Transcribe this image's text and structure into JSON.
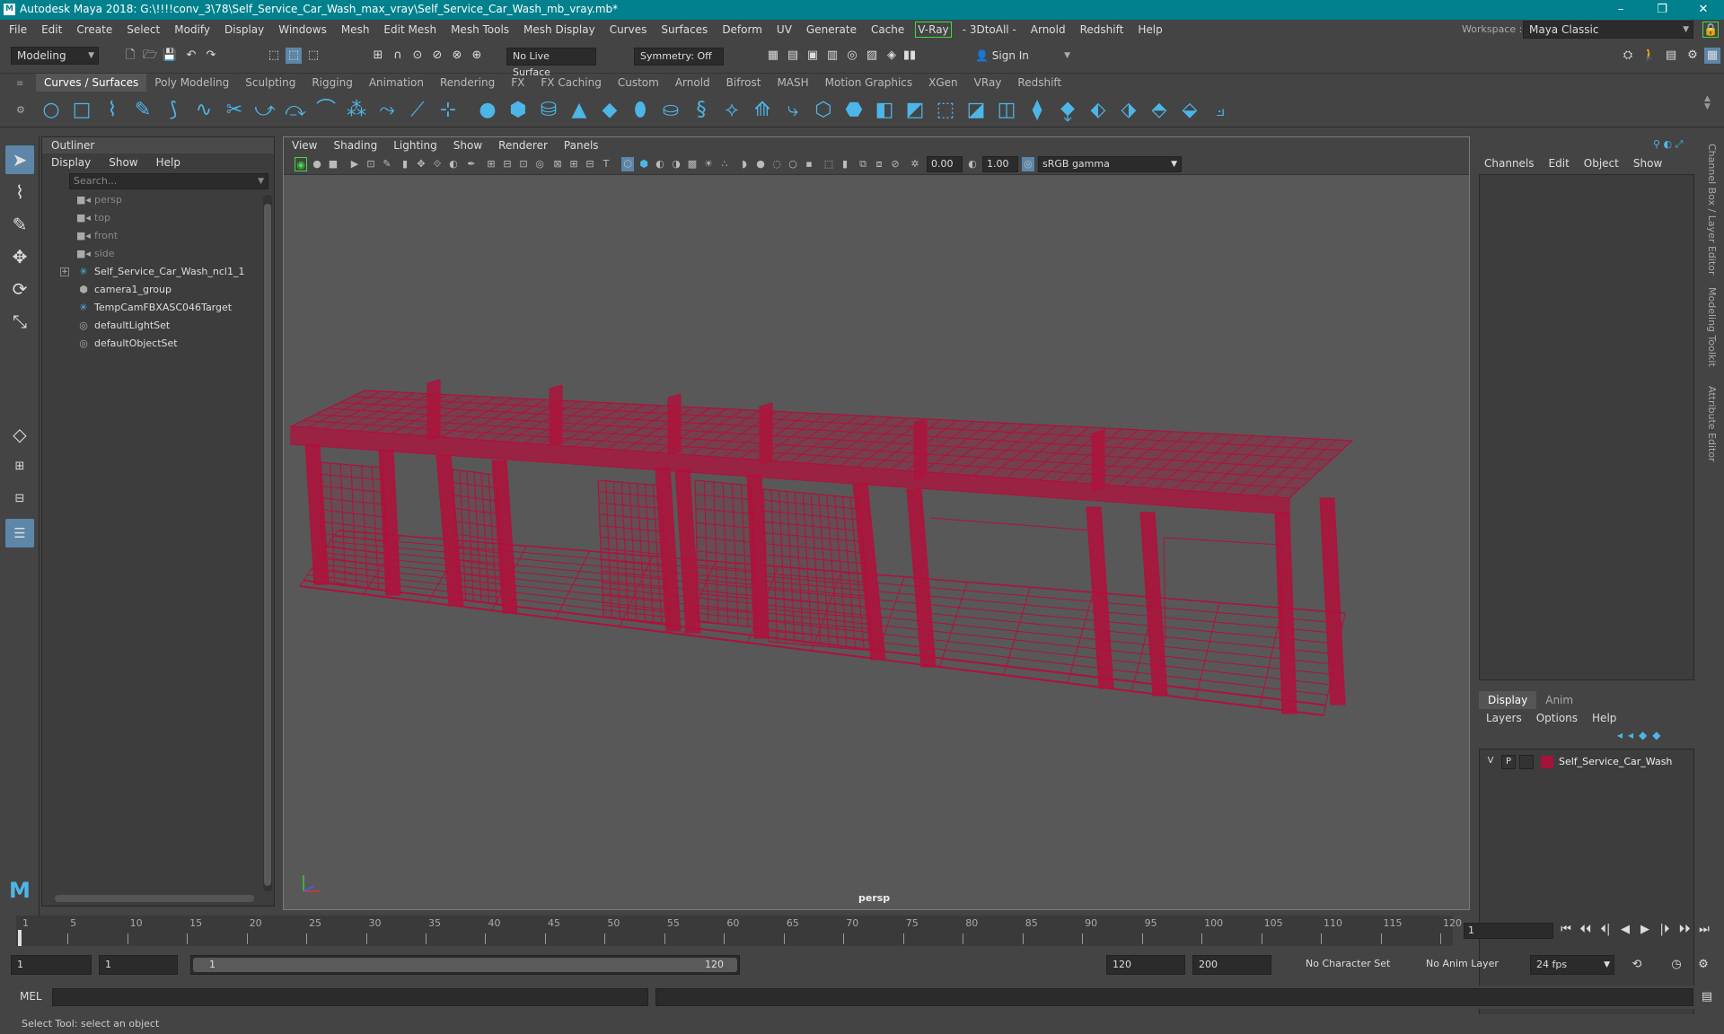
{
  "window": {
    "title": "Autodesk Maya 2018: G:\\!!!!conv_3\\78\\Self_Service_Car_Wash_max_vray\\Self_Service_Car_Wash_mb_vray.mb*",
    "controls": [
      "–",
      "❐",
      "✕"
    ]
  },
  "menubar": {
    "items": [
      "File",
      "Edit",
      "Create",
      "Select",
      "Modify",
      "Display",
      "Windows",
      "Mesh",
      "Edit Mesh",
      "Mesh Tools",
      "Mesh Display",
      "Curves",
      "Surfaces",
      "Deform",
      "UV",
      "Generate",
      "Cache"
    ],
    "vray": "V-Ray",
    "items2": [
      "- 3DtoAll -",
      "Arnold",
      "Redshift",
      "Help"
    ],
    "workspace_label": "Workspace :",
    "workspace_value": "Maya Classic"
  },
  "statusline": {
    "mode": "Modeling",
    "live_surface": "No Live Surface",
    "symmetry": "Symmetry: Off",
    "sign_in": "Sign In"
  },
  "shelf": {
    "tabs": [
      "Curves / Surfaces",
      "Poly Modeling",
      "Sculpting",
      "Rigging",
      "Animation",
      "Rendering",
      "FX",
      "FX Caching",
      "Custom",
      "Arnold",
      "Bifrost",
      "MASH",
      "Motion Graphics",
      "XGen",
      "VRay",
      "Redshift"
    ],
    "active_tab": "Curves / Surfaces"
  },
  "outliner": {
    "title": "Outliner",
    "menu": [
      "Display",
      "Show",
      "Help"
    ],
    "search_placeholder": "Search...",
    "items": [
      {
        "label": "persp",
        "icon": "camera-icon",
        "dim": true
      },
      {
        "label": "top",
        "icon": "camera-icon",
        "dim": true
      },
      {
        "label": "front",
        "icon": "camera-icon",
        "dim": true
      },
      {
        "label": "side",
        "icon": "camera-icon",
        "dim": true
      },
      {
        "label": "Self_Service_Car_Wash_ncl1_1",
        "icon": "transform-icon",
        "dim": false,
        "expandable": true
      },
      {
        "label": "camera1_group",
        "icon": "group-icon",
        "dim": false
      },
      {
        "label": "TempCamFBXASC046Target",
        "icon": "transform-icon",
        "dim": false
      },
      {
        "label": "defaultLightSet",
        "icon": "set-icon",
        "dim": false
      },
      {
        "label": "defaultObjectSet",
        "icon": "set-icon",
        "dim": false
      }
    ]
  },
  "viewport": {
    "menu": [
      "View",
      "Shading",
      "Lighting",
      "Show",
      "Renderer",
      "Panels"
    ],
    "exposure": "0.00",
    "gamma": "1.00",
    "colorspace": "sRGB gamma",
    "camera_label": "persp",
    "wire_color": "#b0113c"
  },
  "channelbox": {
    "menu": [
      "Channels",
      "Edit",
      "Object",
      "Show"
    ],
    "layer_tabs": [
      "Display",
      "Anim"
    ],
    "active_layer_tab": "Display",
    "layer_menu": [
      "Layers",
      "Options",
      "Help"
    ],
    "layer": {
      "v": "V",
      "p": "P",
      "name": "Self_Service_Car_Wash",
      "color": "#a4143a"
    },
    "side_tabs": [
      "Channel Box / Layer Editor",
      "Modeling Toolkit",
      "Attribute Editor"
    ]
  },
  "timeslider": {
    "ticks": [
      "1",
      "5",
      "10",
      "15",
      "20",
      "25",
      "30",
      "35",
      "40",
      "45",
      "50",
      "55",
      "60",
      "65",
      "70",
      "75",
      "80",
      "85",
      "90",
      "95",
      "100",
      "105",
      "110",
      "115",
      "120"
    ],
    "current_frame": "1"
  },
  "range": {
    "start": "1",
    "playback_start": "1",
    "slider_start": "1",
    "slider_end": "120",
    "playback_end": "120",
    "end": "200",
    "character_set": "No Character Set",
    "anim_layer": "No Anim Layer",
    "fps": "24 fps"
  },
  "commandline": {
    "label": "MEL"
  },
  "helpline": {
    "text": "Select Tool: select an object"
  }
}
